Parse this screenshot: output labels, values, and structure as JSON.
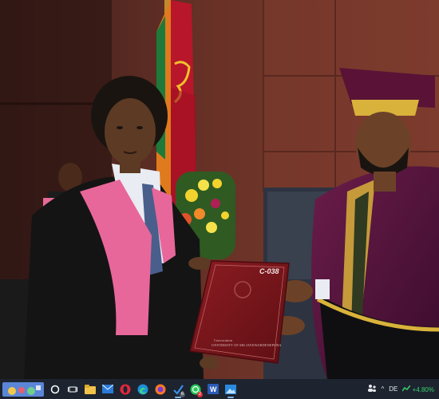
{
  "scene": {
    "certificate": {
      "code": "C-038",
      "line1": "Convocation",
      "line2": "UNIVERSITY OF SRI JAYEWARDENEPURA"
    }
  },
  "taskbar": {
    "items": [
      {
        "name": "search-widget-icon",
        "running": false
      },
      {
        "name": "cortana-circle-icon",
        "running": false
      },
      {
        "name": "task-view-icon",
        "running": false
      },
      {
        "name": "file-explorer-icon",
        "running": false
      },
      {
        "name": "mail-icon",
        "running": false
      },
      {
        "name": "opera-icon",
        "running": false
      },
      {
        "name": "edge-icon",
        "running": false
      },
      {
        "name": "firefox-icon",
        "running": false
      },
      {
        "name": "todo-check-icon",
        "running": true,
        "badge": "6"
      },
      {
        "name": "whatsapp-icon",
        "running": false,
        "badge": "2"
      },
      {
        "name": "word-icon",
        "running": false
      },
      {
        "name": "photos-icon",
        "running": true
      }
    ],
    "tray": {
      "people_icon": "people-icon",
      "chevron": "^",
      "language": "DE",
      "stock_change": "+4.80%"
    }
  }
}
